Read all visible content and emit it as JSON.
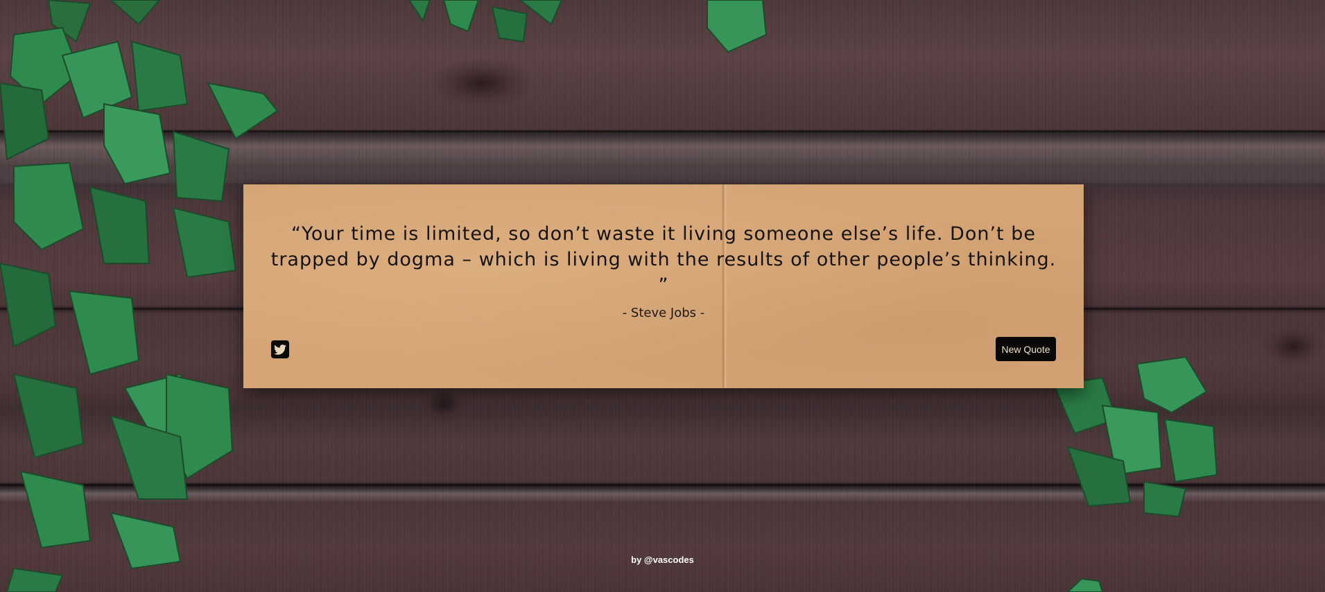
{
  "quote": {
    "text": "“Your time is limited, so don’t waste it living someone else’s life. Don’t be trapped by dogma – which is living with the results of other people’s thinking. ”",
    "author": "- Steve Jobs -"
  },
  "actions": {
    "tweet_icon": "twitter-icon",
    "new_quote_label": "New Quote"
  },
  "footer": {
    "credit": "by @vascodes"
  },
  "colors": {
    "card": "#d4a475",
    "button": "#0a0808",
    "wood": "#4a3538",
    "leaf": "#2f8a4e"
  }
}
